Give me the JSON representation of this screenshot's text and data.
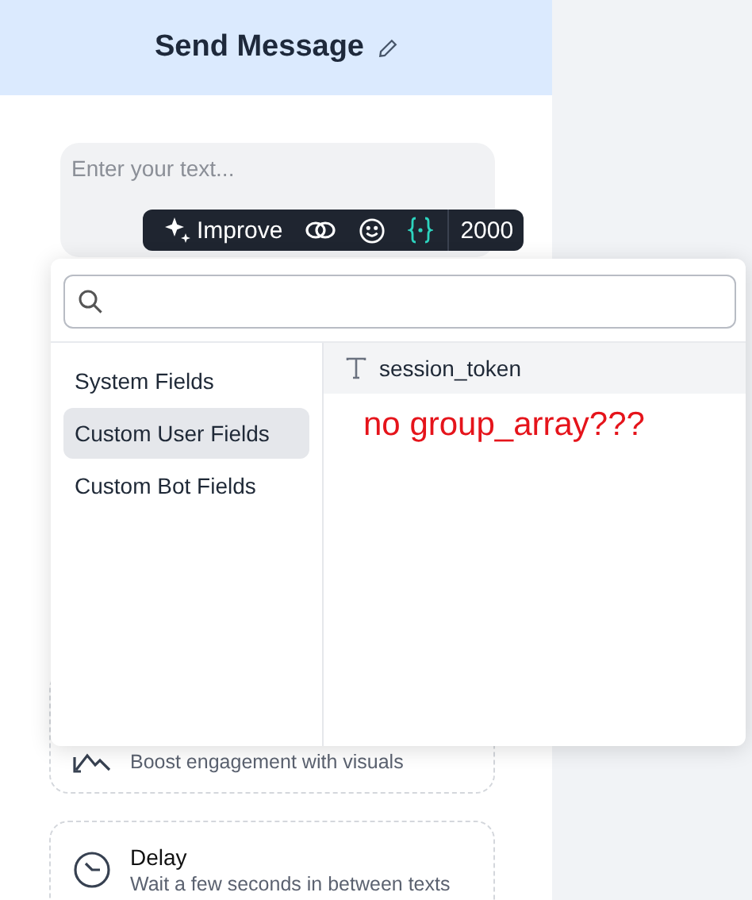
{
  "panel": {
    "title": "Send Message",
    "message_field": {
      "placeholder": "Enter your text..."
    },
    "cards": [
      {
        "kind": "image",
        "subtitle": "Boost engagement with visuals"
      },
      {
        "kind": "delay",
        "title": "Delay",
        "subtitle": "Wait a few seconds in between texts"
      }
    ]
  },
  "toolbar": {
    "tools": [
      {
        "kind": "improve",
        "label": "Improve",
        "active": false
      },
      {
        "kind": "link",
        "active": false
      },
      {
        "kind": "emoji",
        "active": false
      },
      {
        "kind": "variables",
        "active": true
      }
    ],
    "char_count": "2000"
  },
  "field_picker": {
    "categories": [
      {
        "label": "System Fields",
        "selected": false
      },
      {
        "label": "Custom User Fields",
        "selected": true
      },
      {
        "label": "Custom Bot Fields",
        "selected": false
      }
    ],
    "fields": [
      {
        "name": "session_token"
      }
    ]
  },
  "annotation": "no group_array???"
}
